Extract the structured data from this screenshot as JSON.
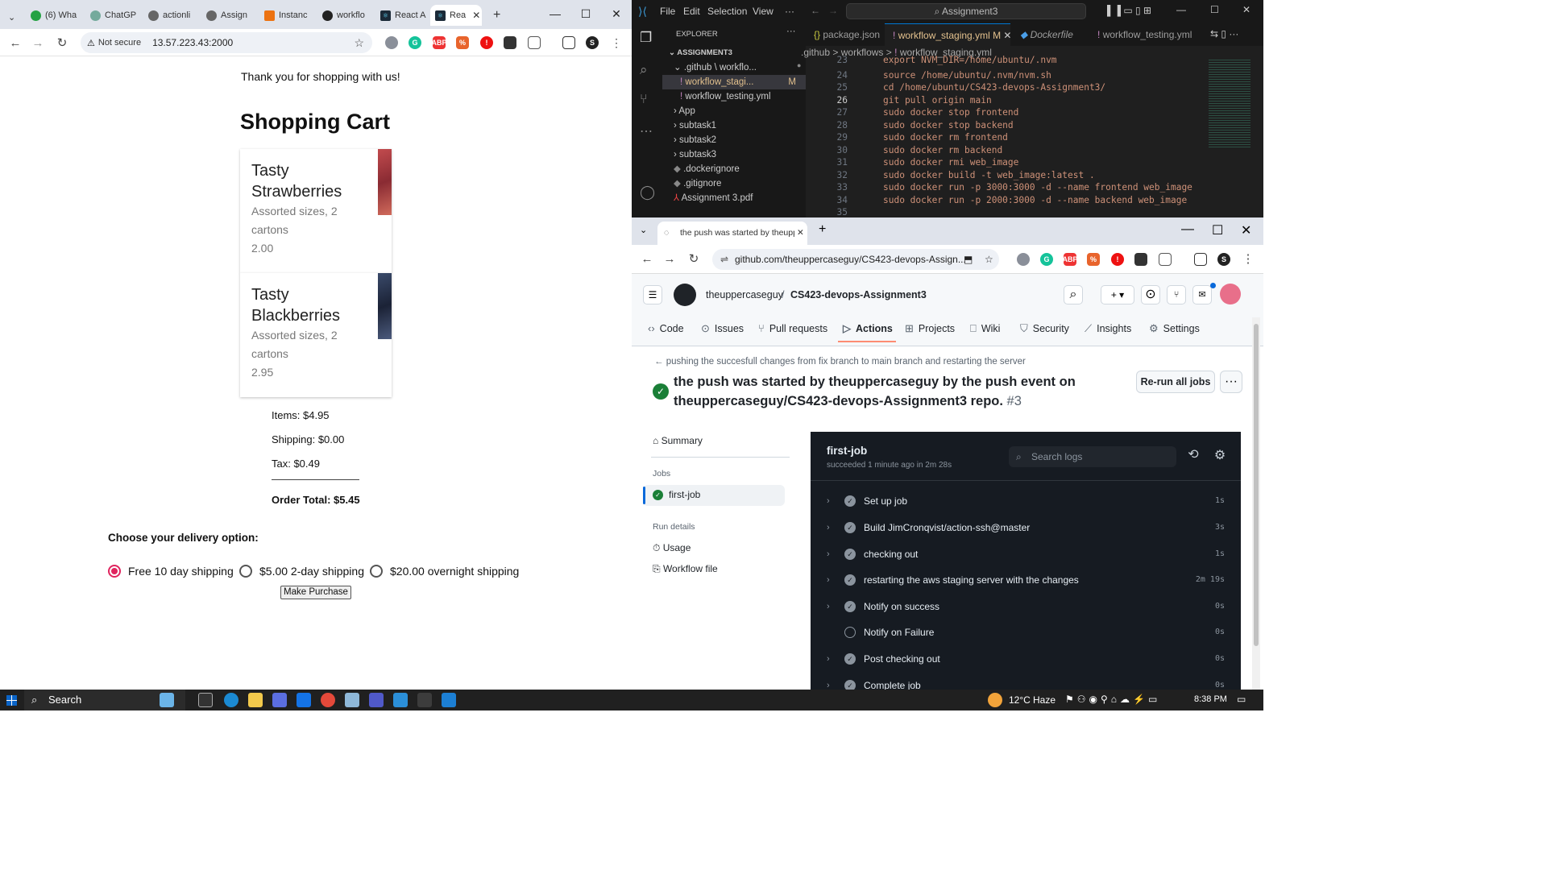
{
  "left_browser": {
    "tabs": [
      {
        "label": "(6) Wha"
      },
      {
        "label": "ChatGP"
      },
      {
        "label": "actionli"
      },
      {
        "label": "Assign"
      },
      {
        "label": "Instanc"
      },
      {
        "label": "workflo"
      },
      {
        "label": "React A"
      },
      {
        "label": "Rea"
      }
    ],
    "security": "Not secure",
    "url": "13.57.223.43:2000"
  },
  "shop": {
    "thanks": "Thank you for shopping with us!",
    "title": "Shopping Cart",
    "items": [
      {
        "name": "Tasty Strawberries",
        "desc": "Assorted sizes, 2 cartons",
        "price": "2.00",
        "img_color": "#b8484a"
      },
      {
        "name": "Tasty Blackberries",
        "desc": "Assorted sizes, 2 cartons",
        "price": "2.95",
        "img_color": "#2f3b55"
      }
    ],
    "items_total": "Items: $4.95",
    "shipping": "Shipping: $0.00",
    "tax": "Tax: $0.49",
    "order_total": "Order Total: $5.45",
    "delivery_heading": "Choose your delivery option:",
    "options": [
      "Free 10 day shipping",
      "$5.00 2-day shipping",
      "$20.00 overnight shipping"
    ],
    "selected_option": "Free 10 day shipping",
    "purchase_button": "Make Purchase"
  },
  "vscode": {
    "menu": [
      "File",
      "Edit",
      "Selection",
      "View",
      "···"
    ],
    "search": "Assignment3",
    "explorer_title": "EXPLORER",
    "root": "ASSIGNMENT3",
    "tree": [
      ".github \\ workflo...",
      "workflow_stagi...",
      "workflow_testing.yml",
      "App",
      "subtask1",
      "subtask2",
      "subtask3",
      ".dockerignore",
      ".gitignore",
      "Assignment 3.pdf"
    ],
    "modified_mark": "M",
    "tabs": [
      "package.json",
      "workflow_staging.yml M",
      "Dockerfile",
      "workflow_testing.yml"
    ],
    "breadcrumb": [
      ".github",
      ">",
      "workflows",
      ">",
      "workflow_staging.yml"
    ],
    "line_numbers": [
      "23",
      "24",
      "25",
      "26",
      "27",
      "28",
      "29",
      "30",
      "31",
      "32",
      "33",
      "34",
      "35"
    ],
    "code": [
      "export NVM_DIR=/home/ubuntu/.nvm",
      "source /home/ubuntu/.nvm/nvm.sh",
      "cd /home/ubuntu/CS423-devops-Assignment3/",
      "git pull origin main",
      "sudo docker stop frontend",
      "sudo docker stop backend",
      "sudo docker rm frontend",
      "sudo docker rm backend",
      "sudo docker rmi web_image",
      "sudo docker build -t web_image:latest .",
      "sudo docker run -p 3000:3000 -d --name frontend web_image",
      "sudo docker run -p 2000:3000 -d --name backend web_image",
      ""
    ]
  },
  "github": {
    "tab_title": "the push was started by theupp",
    "url": "github.com/theuppercaseguy/CS423-devops-Assign...",
    "owner": "theuppercaseguy",
    "sep": "/",
    "repo": "CS423-devops-Assignment3",
    "nav": [
      "Code",
      "Issues",
      "Pull requests",
      "Actions",
      "Projects",
      "Wiki",
      "Security",
      "Insights",
      "Settings"
    ],
    "back_link": "pushing the succesfull changes from fix branch to main branch and restarting the server",
    "run_title": "the push was started by theuppercaseguy by the push event on theuppercaseguy/CS423-devops-Assignment3 repo.",
    "run_number": "#3",
    "rerun": "Re-run all jobs",
    "summary": "Summary",
    "jobs_label": "Jobs",
    "job": "first-job",
    "run_details": "Run details",
    "usage": "Usage",
    "workflow_file": "Workflow file",
    "log_job": "first-job",
    "log_status": "succeeded 1 minute ago in 2m 28s",
    "search_logs": "Search logs",
    "steps": [
      {
        "name": "Set up job",
        "dur": "1s",
        "ok": true
      },
      {
        "name": "Build JimCronqvist/action-ssh@master",
        "dur": "3s",
        "ok": true
      },
      {
        "name": "checking out",
        "dur": "1s",
        "ok": true
      },
      {
        "name": "restarting the aws staging server with the changes",
        "dur": "2m 19s",
        "ok": true
      },
      {
        "name": "Notify on success",
        "dur": "0s",
        "ok": true
      },
      {
        "name": "Notify on Failure",
        "dur": "0s",
        "ok": false
      },
      {
        "name": "Post checking out",
        "dur": "0s",
        "ok": true
      },
      {
        "name": "Complete job",
        "dur": "0s",
        "ok": true
      }
    ]
  },
  "taskbar": {
    "search": "Search",
    "weather": "12°C",
    "weather_text": "Haze",
    "time": "8:38 PM"
  }
}
